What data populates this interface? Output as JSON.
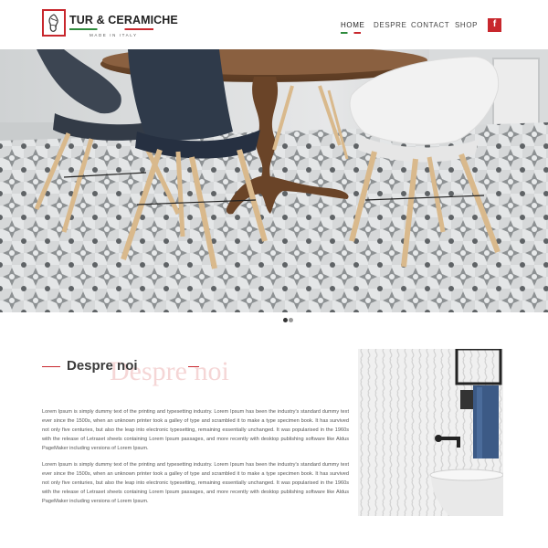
{
  "brand": {
    "name": "TUR & CERAMICHE",
    "tagline": "MADE IN ITALY",
    "colors": {
      "accent": "#c8272d",
      "green": "#2e8b3d"
    }
  },
  "nav": {
    "items": [
      {
        "label": "HOME",
        "active": true
      },
      {
        "label": "DESPRE",
        "active": false
      },
      {
        "label": "CONTACT",
        "active": false
      },
      {
        "label": "SHOP",
        "active": false
      }
    ],
    "social_icon": "facebook-icon",
    "social_glyph": "f"
  },
  "hero": {
    "image": "dining room with patterned grey floor tiles, round wooden table and dark and white chairs",
    "slides_total": 2,
    "active_slide": 1
  },
  "about": {
    "title": "Despre noi",
    "title_ghost": "Despre noi",
    "paragraphs": [
      "Lorem Ipsum is simply dummy text of the printing and typesetting industry. Lorem Ipsum has been the industry's standard dummy text ever since the 1500s, when an unknown printer took a galley of type and scrambled it to make a type specimen book. It has survived not only five centuries, but also the leap into electronic typesetting, remaining essentially unchanged. It was popularised in the 1960s with the release of Letraset sheets containing Lorem Ipsum passages, and more recently with desktop publishing software like Aldus PageMaker including versions of Lorem Ipsum.",
      "Lorem Ipsum is simply dummy text of the printing and typesetting industry. Lorem Ipsum has been the industry's standard dummy text ever since the 1500s, when an unknown printer took a galley of type and scrambled it to make a type specimen book. It has survived not only five centuries, but also the leap into electronic typesetting, remaining essentially unchanged. It was popularised in the 1960s with the release of Letraset sheets containing Lorem Ipsum passages, and more recently with desktop publishing software like Aldus PageMaker including versions of Lorem Ipsum."
    ],
    "side_image": "bathroom wall with white textured tiles, black faucet, sink and blue towel"
  }
}
